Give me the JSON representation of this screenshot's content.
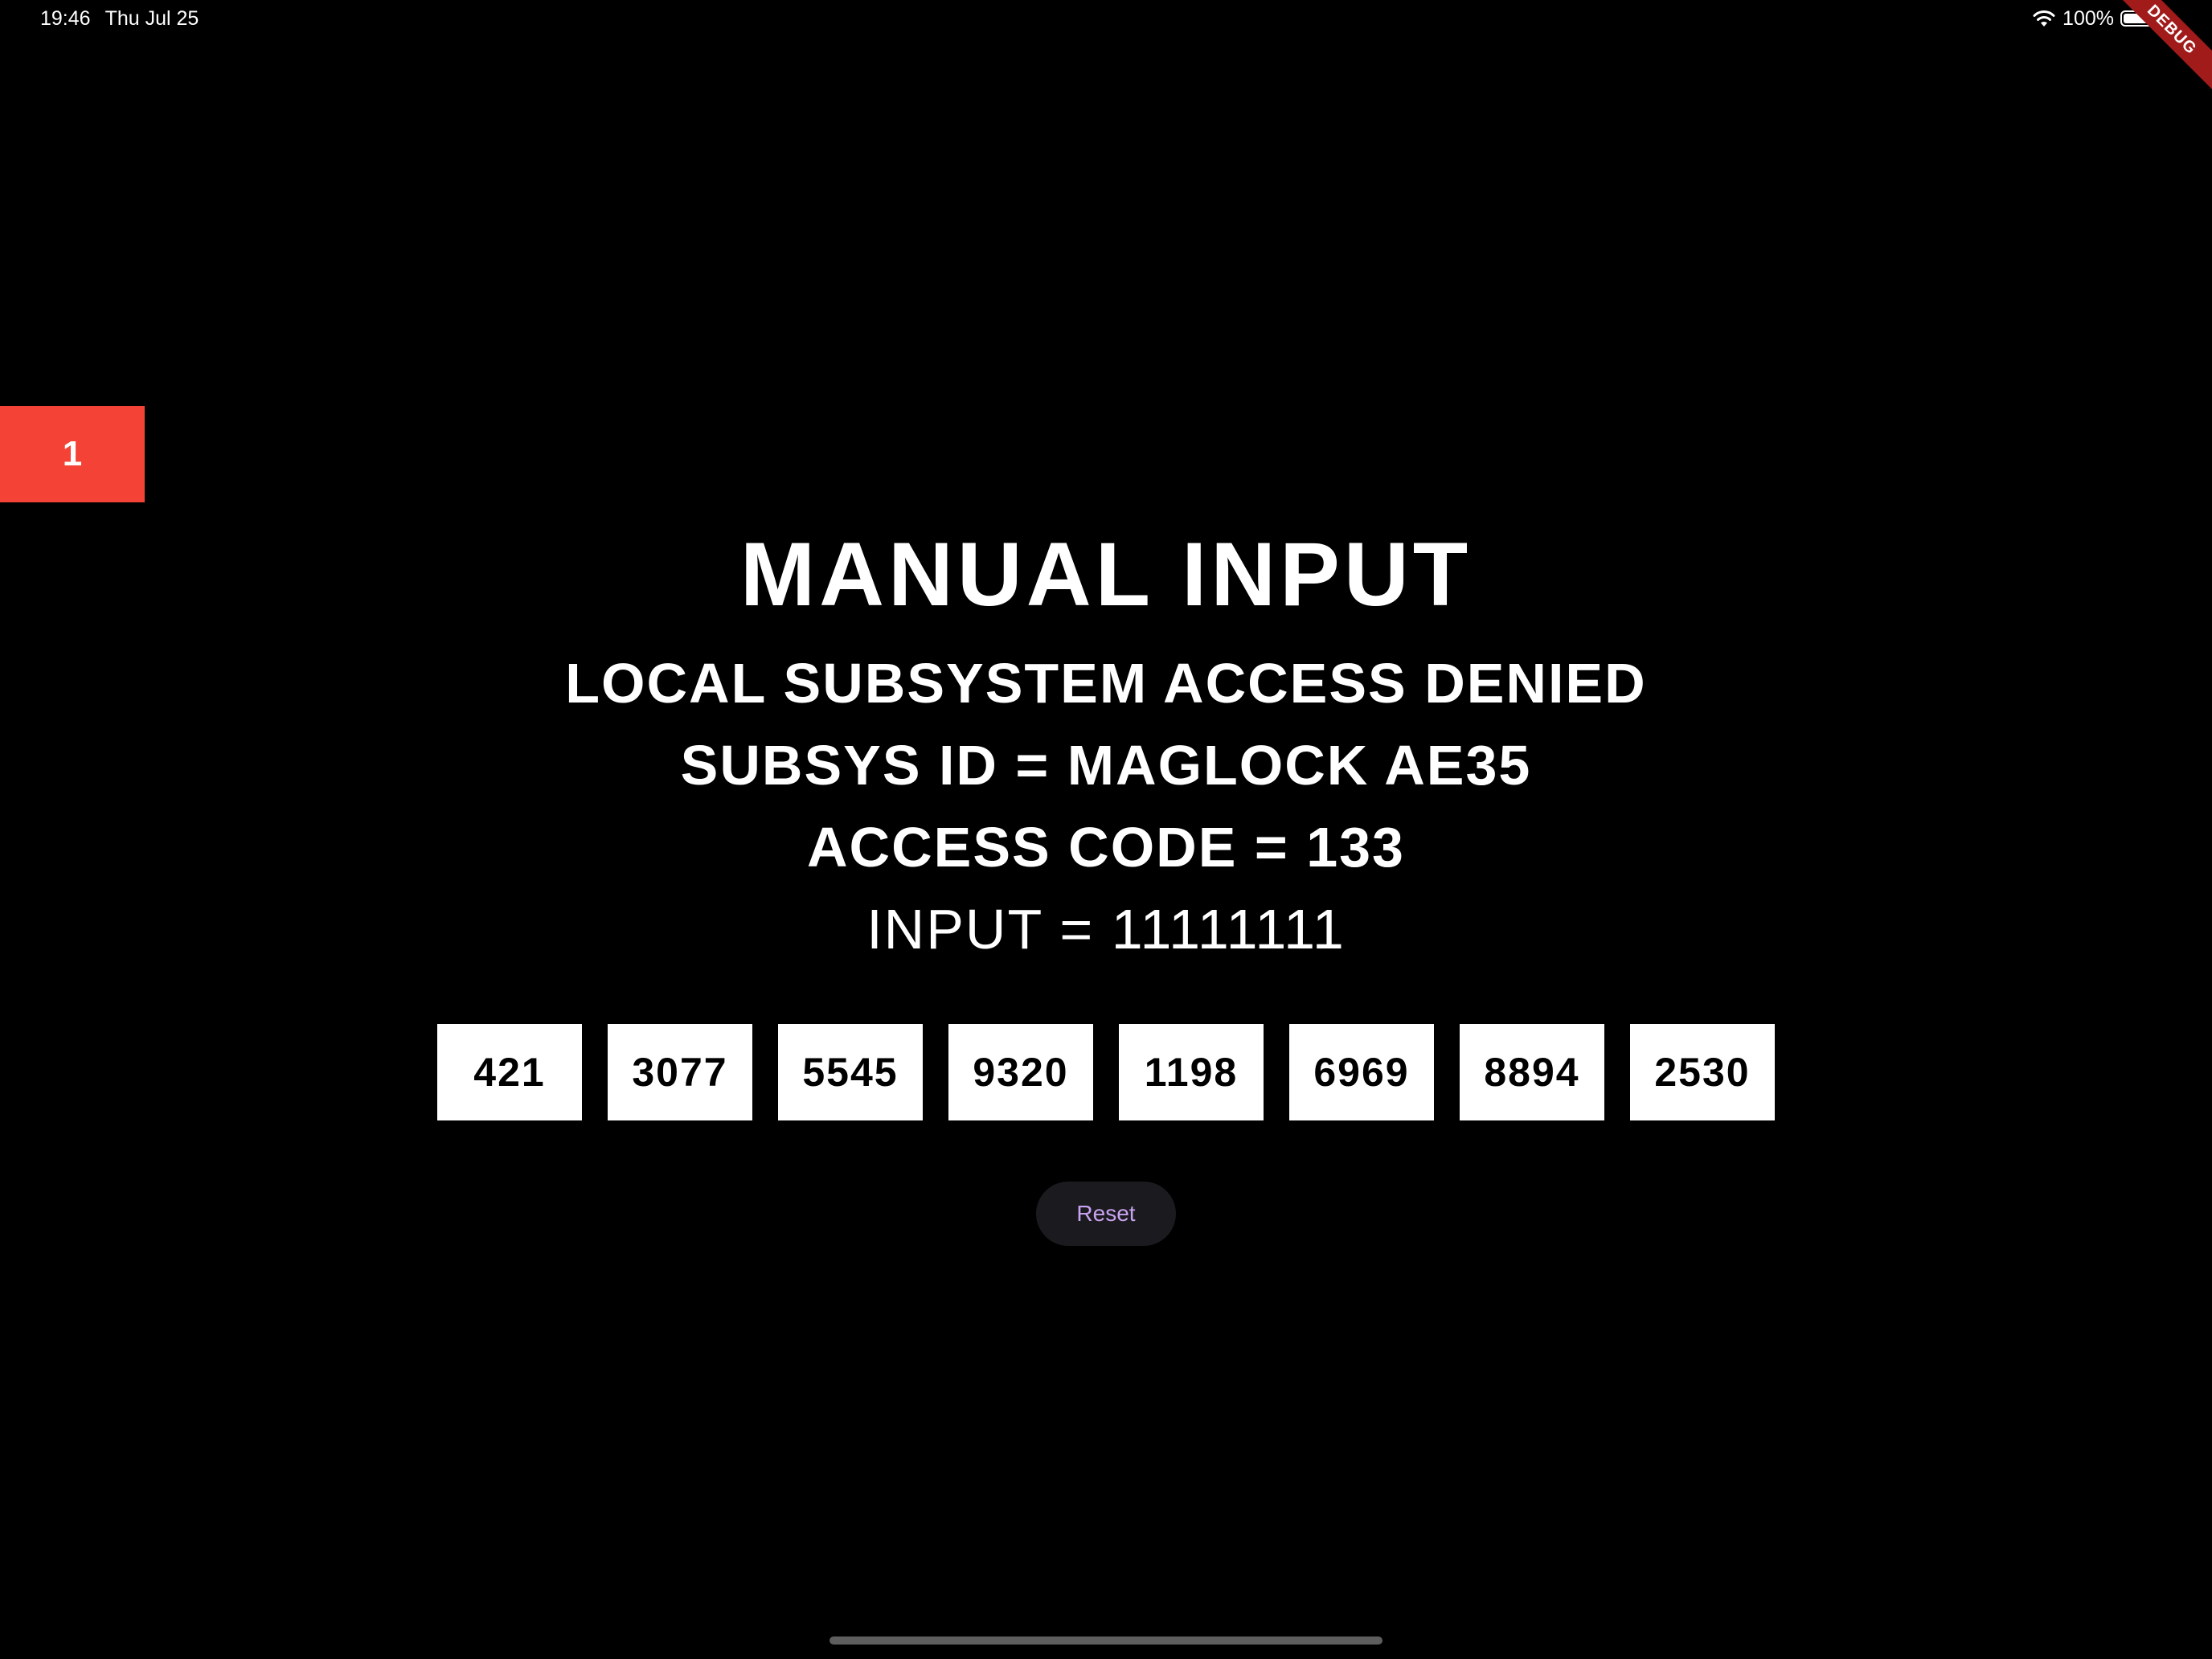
{
  "status_bar": {
    "time": "19:46",
    "date": "Thu Jul 25",
    "battery": "100%",
    "battery_level": 1.0
  },
  "debug_banner": "DEBUG",
  "counter": "1",
  "header": {
    "title": "MANUAL INPUT",
    "lines": [
      "LOCAL SUBSYSTEM ACCESS DENIED",
      "SUBSYS ID = MAGLOCK AE35",
      "ACCESS CODE = 133",
      "INPUT = 11111111"
    ]
  },
  "codes": [
    "421",
    "3077",
    "5545",
    "9320",
    "1198",
    "6969",
    "8894",
    "2530"
  ],
  "reset_label": "Reset",
  "colors": {
    "background": "#000000",
    "counter_bg": "#f44336",
    "reset_text": "#c8a2f0",
    "debug_ribbon": "#a21b1b"
  }
}
